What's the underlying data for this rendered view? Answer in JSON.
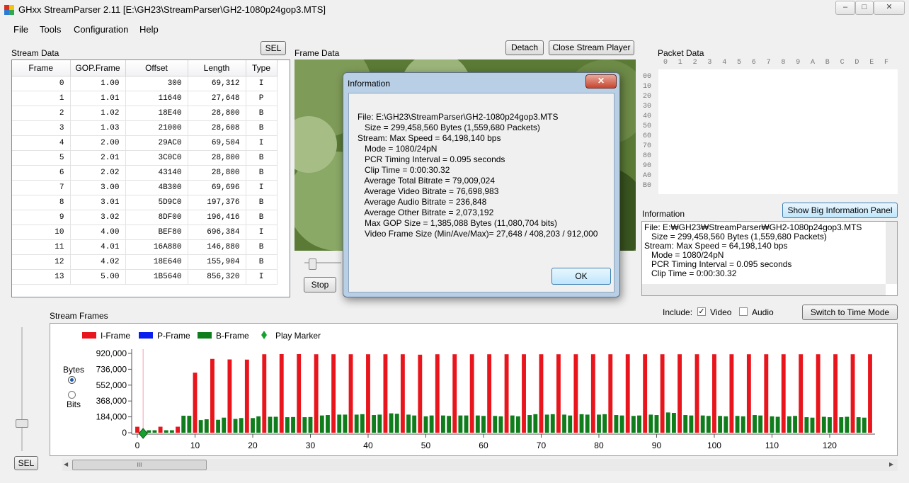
{
  "window": {
    "title": "GHxx StreamParser 2.11 [E:\\GH23\\StreamParser\\GH2-1080p24gop3.MTS]",
    "min": "–",
    "max": "□",
    "close": "✕"
  },
  "menu": [
    "File",
    "Tools",
    "Configuration",
    "Help"
  ],
  "stream_data": {
    "label": "Stream Data",
    "sel_label": "SEL",
    "columns": [
      "Frame",
      "GOP.Frame",
      "Offset",
      "Length",
      "Type"
    ],
    "rows": [
      [
        "0",
        "1.00",
        "300",
        "69,312",
        "I"
      ],
      [
        "1",
        "1.01",
        "11640",
        "27,648",
        "P"
      ],
      [
        "2",
        "1.02",
        "18E40",
        "28,800",
        "B"
      ],
      [
        "3",
        "1.03",
        "21000",
        "28,608",
        "B"
      ],
      [
        "4",
        "2.00",
        "29AC0",
        "69,504",
        "I"
      ],
      [
        "5",
        "2.01",
        "3C0C0",
        "28,800",
        "B"
      ],
      [
        "6",
        "2.02",
        "43140",
        "28,800",
        "B"
      ],
      [
        "7",
        "3.00",
        "4B300",
        "69,696",
        "I"
      ],
      [
        "8",
        "3.01",
        "5D9C0",
        "197,376",
        "B"
      ],
      [
        "9",
        "3.02",
        "8DF00",
        "196,416",
        "B"
      ],
      [
        "10",
        "4.00",
        "BEF80",
        "696,384",
        "I"
      ],
      [
        "11",
        "4.01",
        "16A880",
        "146,880",
        "B"
      ],
      [
        "12",
        "4.02",
        "18E640",
        "155,904",
        "B"
      ],
      [
        "13",
        "5.00",
        "1B5640",
        "856,320",
        "I"
      ]
    ]
  },
  "frame_data": {
    "label": "Frame Data",
    "detach": "Detach",
    "close_player": "Close Stream Player",
    "stop": "Stop"
  },
  "packet_data": {
    "label": "Packet Data",
    "cols": [
      "0",
      "1",
      "2",
      "3",
      "4",
      "5",
      "6",
      "7",
      "8",
      "9",
      "A",
      "B",
      "C",
      "D",
      "E",
      "F"
    ],
    "rows": [
      "00",
      "10",
      "20",
      "30",
      "40",
      "50",
      "60",
      "70",
      "80",
      "90",
      "A0",
      "B0"
    ]
  },
  "information": {
    "label": "Information",
    "big_panel": "Show Big Information Panel",
    "lines": [
      "File: E:₩GH23₩StreamParser₩GH2-1080p24gop3.MTS",
      "   Size = 299,458,560 Bytes (1,559,680 Packets)",
      "Stream: Max Speed = 64,198,140 bps",
      "   Mode = 1080/24pN",
      "   PCR Timing Interval = 0.095 seconds",
      "   Clip Time = 0:00:30.32"
    ]
  },
  "dialog": {
    "title": "Information",
    "close": "✕",
    "ok": "OK",
    "lines": [
      "File: E:\\GH23\\StreamParser\\GH2-1080p24gop3.MTS",
      "   Size = 299,458,560 Bytes (1,559,680 Packets)",
      "Stream: Max Speed = 64,198,140 bps",
      "   Mode = 1080/24pN",
      "   PCR Timing Interval = 0.095 seconds",
      "   Clip Time = 0:00:30.32",
      "   Average Total Bitrate = 79,009,024",
      "   Average Video Bitrate = 76,698,983",
      "   Average Audio Bitrate = 236,848",
      "   Average Other Bitrate = 2,073,192",
      "   Max GOP Size = 1,385,088 Bytes (11,080,704 bits)",
      "   Video Frame Size (Min/Ave/Max)= 27,648 / 408,203 / 912,000"
    ]
  },
  "stream_frames": {
    "label": "Stream Frames",
    "include_label": "Include:",
    "video_label": "Video",
    "audio_label": "Audio",
    "video_checked": true,
    "audio_checked": false,
    "time_mode": "Switch to Time Mode",
    "bytes_label": "Bytes",
    "bits_label": "Bits",
    "sel_label": "SEL",
    "scroll_grip": "III"
  },
  "chart_data": {
    "type": "bar",
    "legend": [
      {
        "name": "I-Frame",
        "color": "#e8151c"
      },
      {
        "name": "P-Frame",
        "color": "#0a1ef0"
      },
      {
        "name": "B-Frame",
        "color": "#0f7d1c"
      },
      {
        "name": "Play Marker",
        "color": "#16a02d"
      }
    ],
    "y_ticks": [
      "920,000",
      "736,000",
      "552,000",
      "368,000",
      "184,000",
      "0"
    ],
    "ylim": [
      0,
      920000
    ],
    "x_ticks": [
      0,
      10,
      20,
      30,
      40,
      50,
      60,
      70,
      80,
      90,
      100,
      110,
      120
    ],
    "xlim": [
      0,
      127
    ],
    "play_marker_frame": 1,
    "frames": [
      {
        "f": 0,
        "t": "I",
        "v": 69312
      },
      {
        "f": 1,
        "t": "P",
        "v": 27648
      },
      {
        "f": 2,
        "t": "B",
        "v": 28800
      },
      {
        "f": 3,
        "t": "B",
        "v": 28608
      },
      {
        "f": 4,
        "t": "I",
        "v": 69504
      },
      {
        "f": 5,
        "t": "B",
        "v": 28800
      },
      {
        "f": 6,
        "t": "B",
        "v": 28800
      },
      {
        "f": 7,
        "t": "I",
        "v": 69696
      },
      {
        "f": 8,
        "t": "B",
        "v": 197376
      },
      {
        "f": 9,
        "t": "B",
        "v": 196416
      },
      {
        "f": 10,
        "t": "I",
        "v": 696384
      },
      {
        "f": 11,
        "t": "B",
        "v": 146880
      },
      {
        "f": 12,
        "t": "B",
        "v": 155904
      },
      {
        "f": 13,
        "t": "I",
        "v": 856320
      },
      {
        "f": 14,
        "t": "B",
        "v": 150000
      },
      {
        "f": 15,
        "t": "B",
        "v": 175000
      },
      {
        "f": 16,
        "t": "I",
        "v": 850000
      },
      {
        "f": 17,
        "t": "B",
        "v": 160000
      },
      {
        "f": 18,
        "t": "B",
        "v": 170000
      },
      {
        "f": 19,
        "t": "I",
        "v": 848000
      },
      {
        "f": 20,
        "t": "B",
        "v": 170000
      },
      {
        "f": 21,
        "t": "B",
        "v": 190000
      },
      {
        "f": 22,
        "t": "I",
        "v": 910000
      },
      {
        "f": 23,
        "t": "B",
        "v": 185000
      },
      {
        "f": 24,
        "t": "B",
        "v": 185000
      },
      {
        "f": 25,
        "t": "I",
        "v": 912000
      },
      {
        "f": 26,
        "t": "B",
        "v": 180000
      },
      {
        "f": 27,
        "t": "B",
        "v": 182000
      },
      {
        "f": 28,
        "t": "I",
        "v": 912000
      },
      {
        "f": 29,
        "t": "B",
        "v": 180000
      },
      {
        "f": 30,
        "t": "B",
        "v": 182000
      },
      {
        "f": 31,
        "t": "I",
        "v": 910000
      },
      {
        "f": 32,
        "t": "B",
        "v": 200000
      },
      {
        "f": 33,
        "t": "B",
        "v": 205000
      },
      {
        "f": 34,
        "t": "I",
        "v": 910000
      },
      {
        "f": 35,
        "t": "B",
        "v": 210000
      },
      {
        "f": 36,
        "t": "B",
        "v": 210000
      },
      {
        "f": 37,
        "t": "I",
        "v": 910000
      },
      {
        "f": 38,
        "t": "B",
        "v": 210000
      },
      {
        "f": 39,
        "t": "B",
        "v": 215000
      },
      {
        "f": 40,
        "t": "I",
        "v": 910000
      },
      {
        "f": 41,
        "t": "B",
        "v": 205000
      },
      {
        "f": 42,
        "t": "B",
        "v": 210000
      },
      {
        "f": 43,
        "t": "I",
        "v": 910000
      },
      {
        "f": 44,
        "t": "B",
        "v": 225000
      },
      {
        "f": 45,
        "t": "B",
        "v": 220000
      },
      {
        "f": 46,
        "t": "I",
        "v": 910000
      },
      {
        "f": 47,
        "t": "B",
        "v": 210000
      },
      {
        "f": 48,
        "t": "B",
        "v": 200000
      },
      {
        "f": 49,
        "t": "I",
        "v": 905000
      },
      {
        "f": 50,
        "t": "B",
        "v": 190000
      },
      {
        "f": 51,
        "t": "B",
        "v": 200000
      },
      {
        "f": 52,
        "t": "I",
        "v": 910000
      },
      {
        "f": 53,
        "t": "B",
        "v": 200000
      },
      {
        "f": 54,
        "t": "B",
        "v": 195000
      },
      {
        "f": 55,
        "t": "I",
        "v": 910000
      },
      {
        "f": 56,
        "t": "B",
        "v": 200000
      },
      {
        "f": 57,
        "t": "B",
        "v": 200000
      },
      {
        "f": 58,
        "t": "I",
        "v": 910000
      },
      {
        "f": 59,
        "t": "B",
        "v": 200000
      },
      {
        "f": 60,
        "t": "B",
        "v": 195000
      },
      {
        "f": 61,
        "t": "I",
        "v": 910000
      },
      {
        "f": 62,
        "t": "B",
        "v": 195000
      },
      {
        "f": 63,
        "t": "B",
        "v": 190000
      },
      {
        "f": 64,
        "t": "I",
        "v": 910000
      },
      {
        "f": 65,
        "t": "B",
        "v": 200000
      },
      {
        "f": 66,
        "t": "B",
        "v": 190000
      },
      {
        "f": 67,
        "t": "I",
        "v": 910000
      },
      {
        "f": 68,
        "t": "B",
        "v": 205000
      },
      {
        "f": 69,
        "t": "B",
        "v": 215000
      },
      {
        "f": 70,
        "t": "I",
        "v": 910000
      },
      {
        "f": 71,
        "t": "B",
        "v": 210000
      },
      {
        "f": 72,
        "t": "B",
        "v": 215000
      },
      {
        "f": 73,
        "t": "I",
        "v": 910000
      },
      {
        "f": 74,
        "t": "B",
        "v": 210000
      },
      {
        "f": 75,
        "t": "B",
        "v": 200000
      },
      {
        "f": 76,
        "t": "I",
        "v": 910000
      },
      {
        "f": 77,
        "t": "B",
        "v": 215000
      },
      {
        "f": 78,
        "t": "B",
        "v": 210000
      },
      {
        "f": 79,
        "t": "I",
        "v": 910000
      },
      {
        "f": 80,
        "t": "B",
        "v": 210000
      },
      {
        "f": 81,
        "t": "B",
        "v": 215000
      },
      {
        "f": 82,
        "t": "I",
        "v": 910000
      },
      {
        "f": 83,
        "t": "B",
        "v": 205000
      },
      {
        "f": 84,
        "t": "B",
        "v": 200000
      },
      {
        "f": 85,
        "t": "I",
        "v": 910000
      },
      {
        "f": 86,
        "t": "B",
        "v": 195000
      },
      {
        "f": 87,
        "t": "B",
        "v": 200000
      },
      {
        "f": 88,
        "t": "I",
        "v": 910000
      },
      {
        "f": 89,
        "t": "B",
        "v": 210000
      },
      {
        "f": 90,
        "t": "B",
        "v": 205000
      },
      {
        "f": 91,
        "t": "I",
        "v": 910000
      },
      {
        "f": 92,
        "t": "B",
        "v": 235000
      },
      {
        "f": 93,
        "t": "B",
        "v": 230000
      },
      {
        "f": 94,
        "t": "I",
        "v": 910000
      },
      {
        "f": 95,
        "t": "B",
        "v": 205000
      },
      {
        "f": 96,
        "t": "B",
        "v": 200000
      },
      {
        "f": 97,
        "t": "I",
        "v": 910000
      },
      {
        "f": 98,
        "t": "B",
        "v": 200000
      },
      {
        "f": 99,
        "t": "B",
        "v": 195000
      },
      {
        "f": 100,
        "t": "I",
        "v": 910000
      },
      {
        "f": 101,
        "t": "B",
        "v": 195000
      },
      {
        "f": 102,
        "t": "B",
        "v": 190000
      },
      {
        "f": 103,
        "t": "I",
        "v": 910000
      },
      {
        "f": 104,
        "t": "B",
        "v": 195000
      },
      {
        "f": 105,
        "t": "B",
        "v": 190000
      },
      {
        "f": 106,
        "t": "I",
        "v": 910000
      },
      {
        "f": 107,
        "t": "B",
        "v": 205000
      },
      {
        "f": 108,
        "t": "B",
        "v": 200000
      },
      {
        "f": 109,
        "t": "I",
        "v": 910000
      },
      {
        "f": 110,
        "t": "B",
        "v": 190000
      },
      {
        "f": 111,
        "t": "B",
        "v": 185000
      },
      {
        "f": 112,
        "t": "I",
        "v": 910000
      },
      {
        "f": 113,
        "t": "B",
        "v": 190000
      },
      {
        "f": 114,
        "t": "B",
        "v": 195000
      },
      {
        "f": 115,
        "t": "I",
        "v": 910000
      },
      {
        "f": 116,
        "t": "B",
        "v": 180000
      },
      {
        "f": 117,
        "t": "B",
        "v": 175000
      },
      {
        "f": 118,
        "t": "I",
        "v": 910000
      },
      {
        "f": 119,
        "t": "B",
        "v": 185000
      },
      {
        "f": 120,
        "t": "B",
        "v": 180000
      },
      {
        "f": 121,
        "t": "I",
        "v": 910000
      },
      {
        "f": 122,
        "t": "B",
        "v": 180000
      },
      {
        "f": 123,
        "t": "B",
        "v": 185000
      },
      {
        "f": 124,
        "t": "I",
        "v": 910000
      },
      {
        "f": 125,
        "t": "B",
        "v": 180000
      },
      {
        "f": 126,
        "t": "B",
        "v": 175000
      },
      {
        "f": 127,
        "t": "I",
        "v": 910000
      }
    ]
  }
}
